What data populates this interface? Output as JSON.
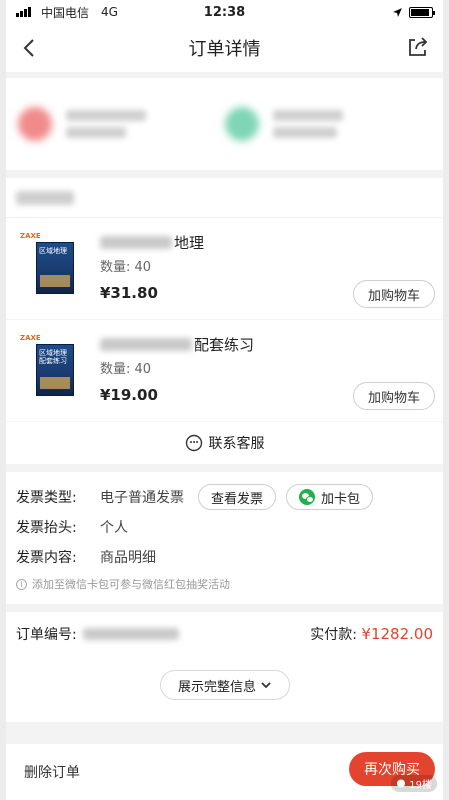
{
  "status_bar": {
    "carrier": "中国电信",
    "network": "4G",
    "time": "12:38",
    "battery_level": 0.9
  },
  "nav": {
    "title": "订单详情",
    "back_icon": "chevron-left-icon",
    "share_icon": "share-icon"
  },
  "products": [
    {
      "title_suffix": "地理",
      "qty": "数量: 40",
      "price": "¥31.80",
      "cart_label": "加购物车",
      "cover_title": "区域地理"
    },
    {
      "title_suffix": "配套练习",
      "qty": "数量: 40",
      "price": "¥19.00",
      "cart_label": "加购物车",
      "cover_title": "区域地理配套练习"
    }
  ],
  "book_brand": "ZAXE",
  "service": {
    "label": "联系客服",
    "icon": "customer-service-icon"
  },
  "invoice": {
    "type_label": "发票类型:",
    "type_value": "电子普通发票",
    "view_label": "查看发票",
    "card_label": "加卡包",
    "header_label": "发票抬头:",
    "header_value": "个人",
    "content_label": "发票内容:",
    "content_value": "商品明细",
    "note": "添加至微信卡包可参与微信红包抽奖活动"
  },
  "order": {
    "number_label": "订单编号:",
    "paid_label": "实付款:",
    "paid_value": "¥1282.00",
    "expand_label": "展示完整信息"
  },
  "bottom": {
    "delete_label": "删除订单",
    "rebuy_label": "再次购买"
  },
  "watermark": "19楼",
  "colors": {
    "accent": "#e4432d",
    "wechat": "#21b14c",
    "background": "#f3f3f3"
  }
}
